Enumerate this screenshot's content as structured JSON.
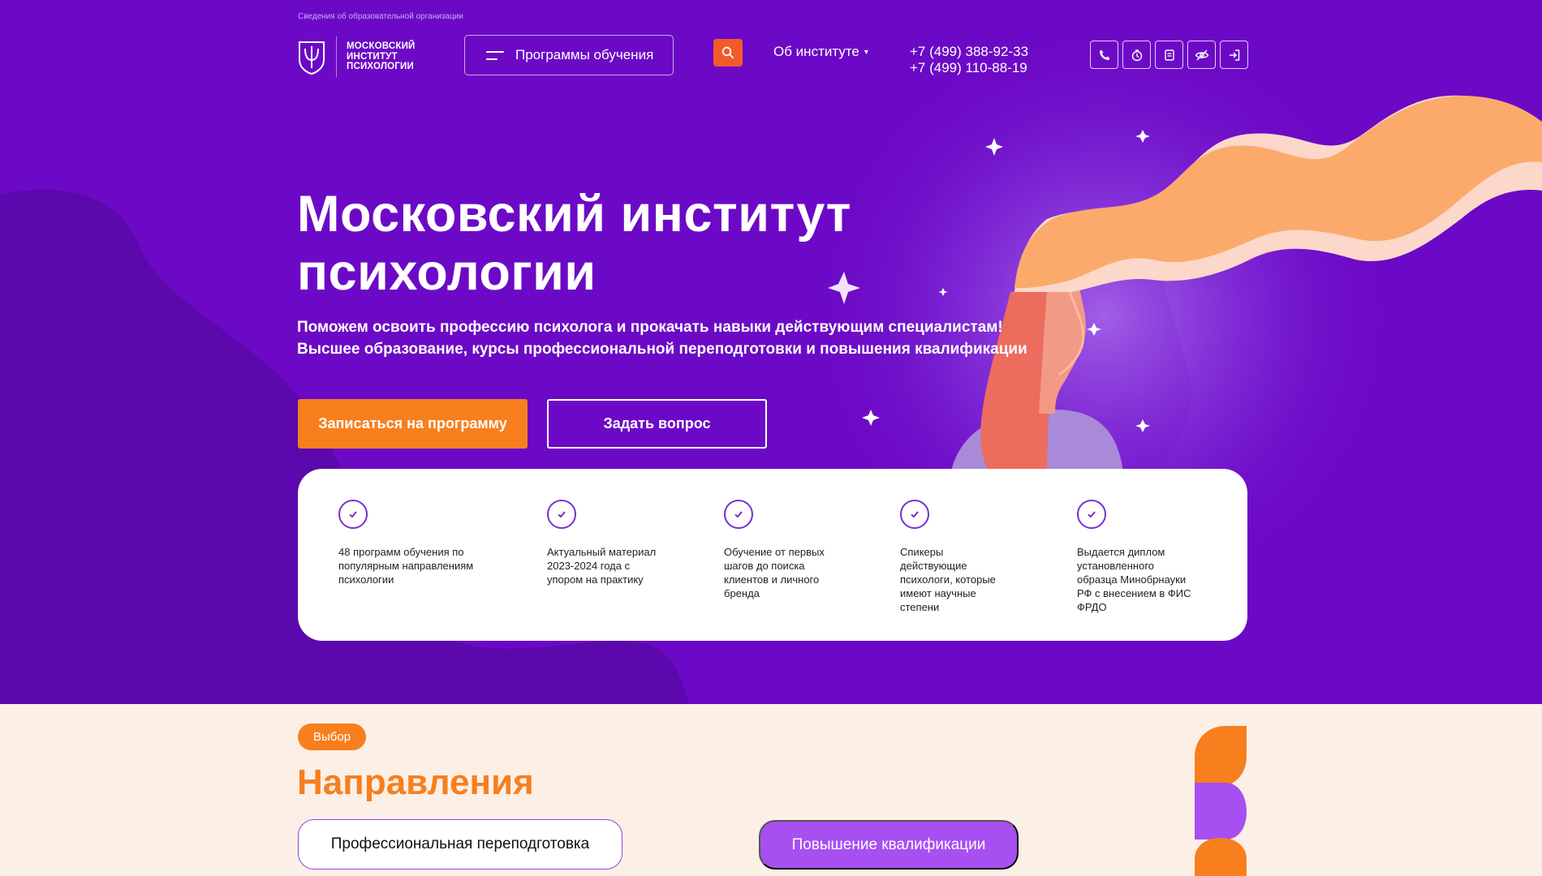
{
  "header": {
    "info_link": "Сведения об образовательной организации",
    "logo_lines": [
      "МОСКОВСКИЙ",
      "ИНСТИТУТ",
      "ПСИХОЛОГИИ"
    ],
    "programs_label": "Программы обучения",
    "about_label": "Об институте",
    "about_caret": "▾",
    "phones": [
      "+7 (499) 388-92-33",
      "+7 (499) 110-88-19"
    ],
    "utility_icons": [
      "phone-icon",
      "timer-icon",
      "document-icon",
      "eye-off-icon",
      "login-icon"
    ]
  },
  "hero": {
    "title_line1": "Московский институт",
    "title_line2": "психологии",
    "subtitle_line1": "Поможем освоить профессию психолога и прокачать навыки действующим специалистам!",
    "subtitle_line2": "Высшее образование, курсы профессиональной переподготовки и повышения квалификации",
    "primary_button": "Записаться на программу",
    "secondary_button": "Задать вопрос"
  },
  "features": [
    {
      "lines": [
        "48 программ обучения по",
        "популярным направлениям",
        "психологии"
      ]
    },
    {
      "lines": [
        "Актуальный материал",
        "2023-2024 года с",
        "упором на практику"
      ]
    },
    {
      "lines": [
        "Обучение от первых",
        "шагов до поиска",
        "клиентов и личного",
        "бренда"
      ]
    },
    {
      "lines": [
        "Спикеры",
        "действующие",
        "психологи, которые",
        "имеют научные",
        "степени"
      ]
    },
    {
      "lines": [
        "Выдается диплом",
        "установленного",
        "образца Минобрнауки",
        "РФ с внесением в ФИС",
        "ФРДО"
      ]
    }
  ],
  "directions": {
    "tag": "Выбор",
    "title": "Направления",
    "tab_retraining": "Профессиональная переподготовка",
    "tab_qualification": "Повышение квалификации"
  },
  "colors": {
    "hero_bg": "#6c09c6",
    "accent_orange": "#f77f1e",
    "search_red": "#f25a2a",
    "violet": "#a74ff1",
    "section_bg": "#fcefe6"
  }
}
